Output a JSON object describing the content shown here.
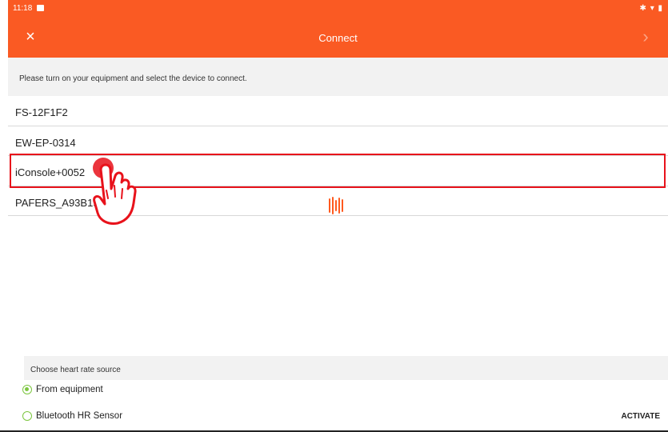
{
  "status_bar": {
    "time": "11:18",
    "icons": "✱ ▾ ▮"
  },
  "app_bar": {
    "title": "Connect",
    "close_icon": "×",
    "next_icon": "›",
    "color": "#fa5a23"
  },
  "instruction": "Please turn on your equipment and select the device to connect.",
  "devices": [
    {
      "name": "FS-12F1F2"
    },
    {
      "name": "EW-EP-0314"
    },
    {
      "name": "iConsole+0052"
    },
    {
      "name": "PAFERS_A93B19"
    }
  ],
  "highlighted_device": "iConsole+0052",
  "heart_rate": {
    "header": "Choose heart rate source",
    "options": [
      {
        "label": "From equipment",
        "checked": true
      },
      {
        "label": "Bluetooth HR Sensor",
        "checked": false
      }
    ],
    "activate_label": "ACTIVATE"
  },
  "colors": {
    "accent": "#fa5a23",
    "highlight": "#e8121b",
    "radio": "#7cc63f"
  }
}
